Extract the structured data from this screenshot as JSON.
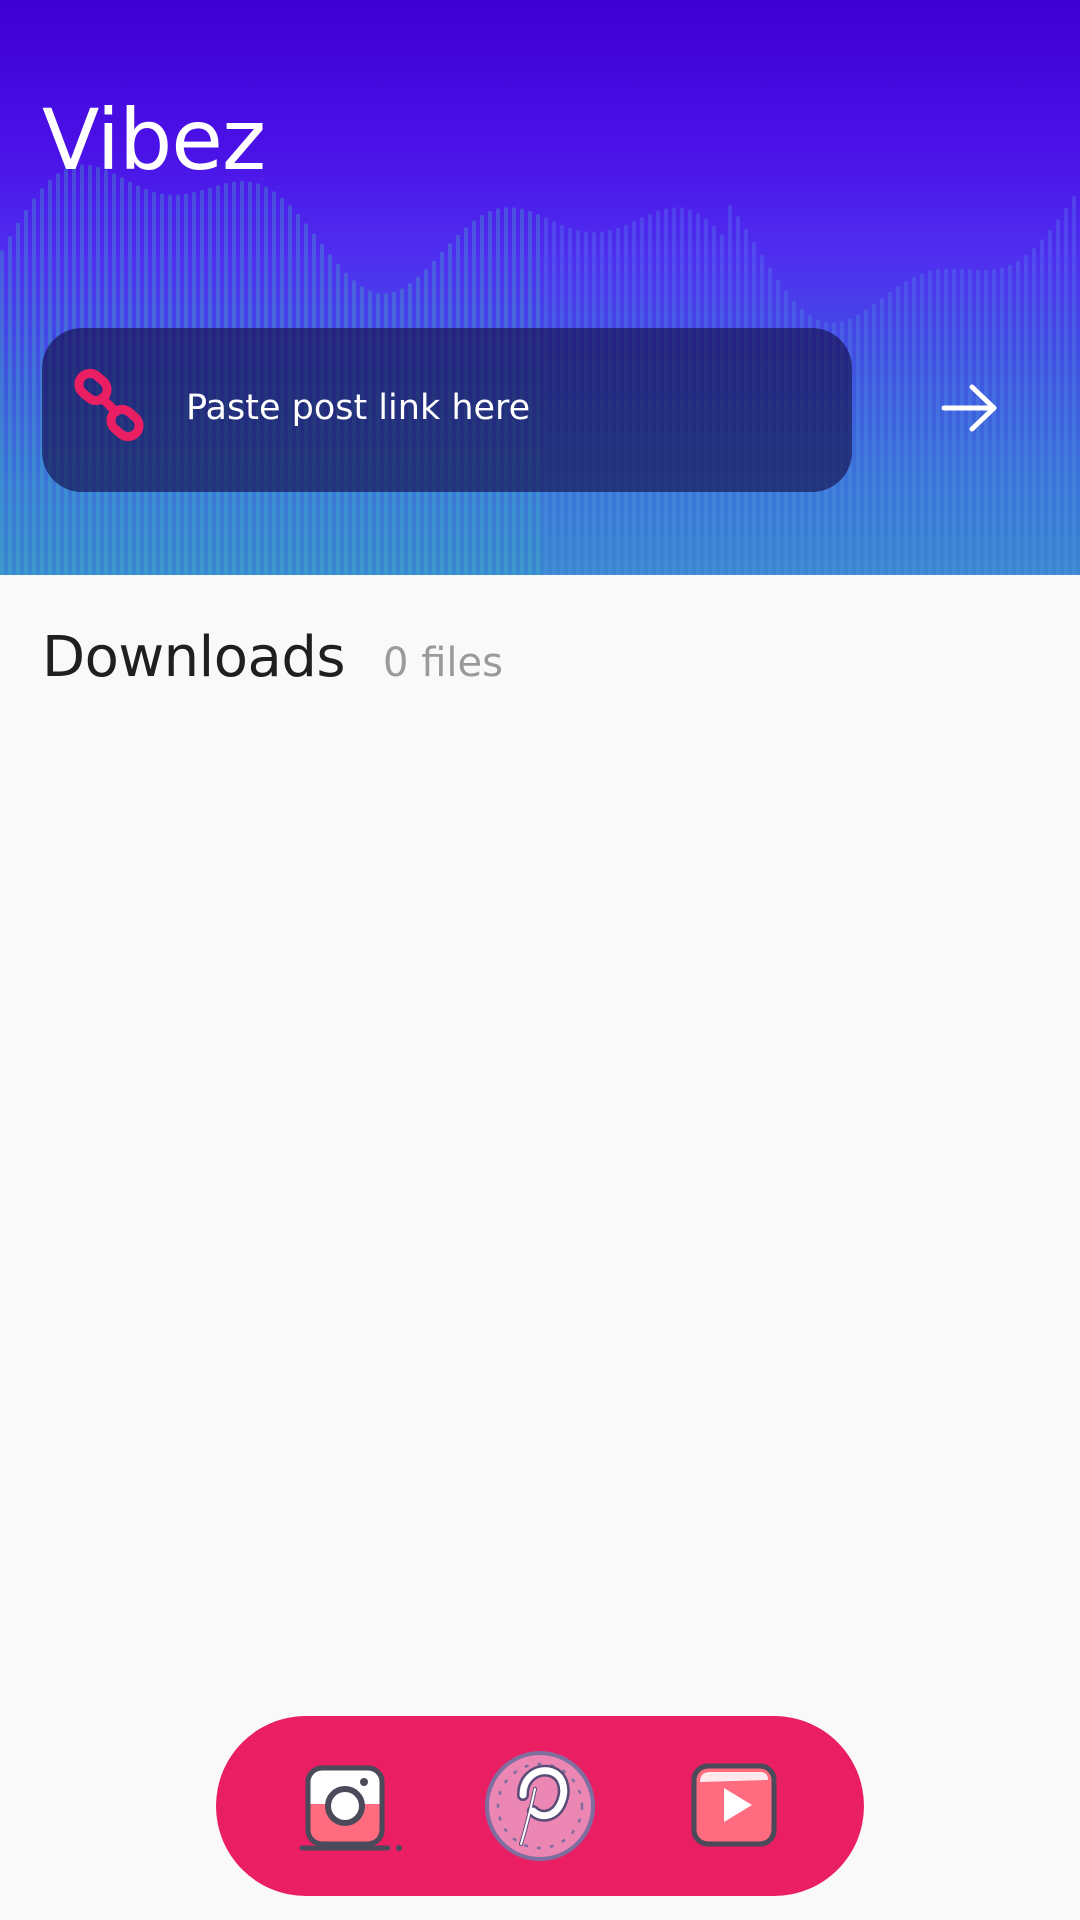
{
  "app": {
    "title": "Vibez"
  },
  "link_input": {
    "placeholder": "Paste post link here",
    "value": ""
  },
  "icons": {
    "link": "link-chain-icon",
    "go": "arrow-right-icon",
    "instagram": "instagram-icon",
    "pinterest": "pinterest-icon",
    "youtube": "youtube-icon"
  },
  "downloads": {
    "title": "Downloads",
    "count_label": "0 files"
  },
  "dock": {
    "items": [
      {
        "name": "Instagram",
        "icon": "instagram-icon"
      },
      {
        "name": "Pinterest",
        "icon": "pinterest-icon",
        "selected": true
      },
      {
        "name": "YouTube",
        "icon": "youtube-icon"
      }
    ]
  },
  "colors": {
    "hero_top": "#3d00d4",
    "hero_bottom": "#3a86cf",
    "accent": "#e91e63",
    "background": "#f9f9fa",
    "text_primary": "#1f1f1f",
    "text_secondary": "#9a9a9a"
  }
}
